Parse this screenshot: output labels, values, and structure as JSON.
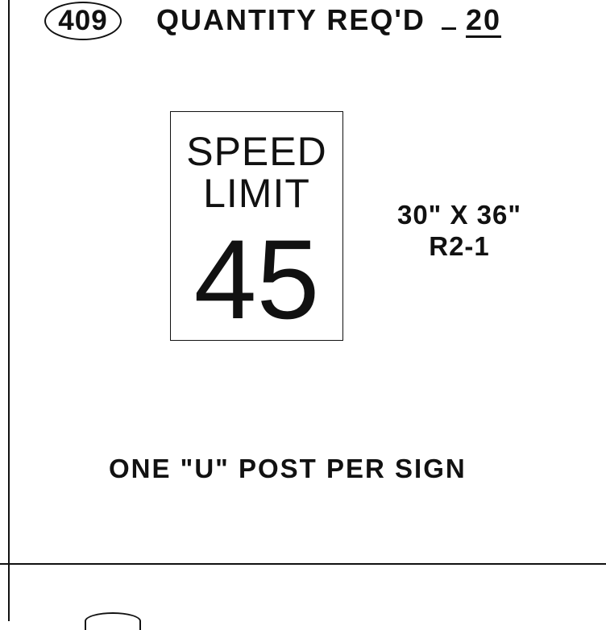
{
  "header": {
    "item_number": "409",
    "quantity_label": "QUANTITY REQ'D",
    "quantity_value": "20"
  },
  "sign": {
    "line_1": "SPEED",
    "line_2": "LIMIT",
    "speed_limit": "45",
    "size": "30\" X 36\"",
    "code": "R2-1"
  },
  "note": "ONE \"U\" POST PER SIGN"
}
